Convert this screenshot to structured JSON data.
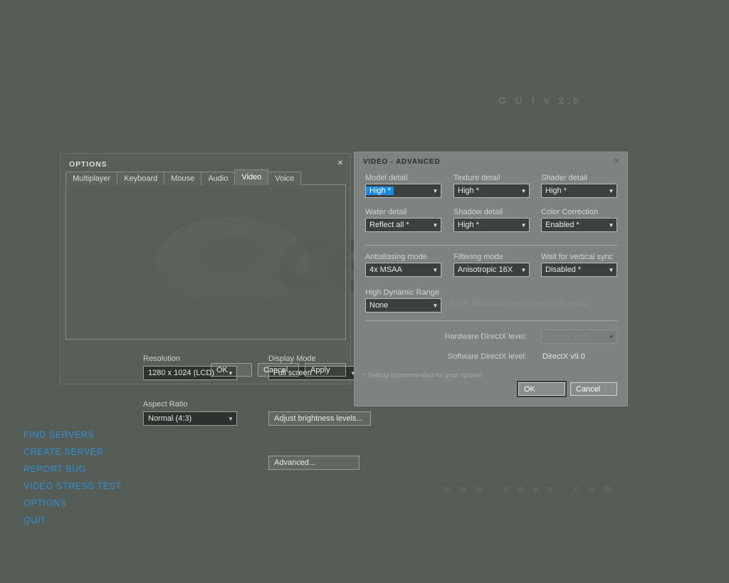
{
  "background": {
    "gui_version": "G U I    v 2.0",
    "site_url": "w w w . c e v o . c o m",
    "watermark_text": "cevo",
    "bg_color": "#565c56"
  },
  "main_menu": {
    "items": [
      {
        "label": "FIND SERVERS"
      },
      {
        "label": "CREATE SERVER"
      },
      {
        "label": "REPORT BUG"
      },
      {
        "label": "VIDEO STRESS TEST"
      },
      {
        "label": "OPTIONS"
      },
      {
        "label": "QUIT"
      }
    ],
    "color": "#2f8fd6"
  },
  "options_window": {
    "title": "OPTIONS",
    "close_label": "×",
    "tabs": [
      {
        "label": "Multiplayer",
        "active": false
      },
      {
        "label": "Keyboard",
        "active": false
      },
      {
        "label": "Mouse",
        "active": false
      },
      {
        "label": "Audio",
        "active": false
      },
      {
        "label": "Video",
        "active": true
      },
      {
        "label": "Voice",
        "active": false
      }
    ],
    "video": {
      "resolution_label": "Resolution",
      "resolution_value": "1280 x 1024 (LCD)",
      "display_mode_label": "Display Mode",
      "display_mode_value": "Full screen",
      "aspect_ratio_label": "Aspect Ratio",
      "aspect_ratio_value": "Normal (4:3)",
      "brightness_button": "Adjust brightness levels...",
      "advanced_button": "Advanced..."
    },
    "footer": {
      "ok": "OK",
      "cancel": "Cancel",
      "apply": "Apply"
    }
  },
  "advanced_window": {
    "title": "VIDEO - ADVANCED",
    "close_label": "×",
    "settings_row1": [
      {
        "label": "Model detail",
        "value": "High *",
        "selected": true
      },
      {
        "label": "Texture detail",
        "value": "High *",
        "selected": false
      },
      {
        "label": "Shader detail",
        "value": "High *",
        "selected": false
      }
    ],
    "settings_row2": [
      {
        "label": "Water detail",
        "value": "Reflect all *",
        "selected": false
      },
      {
        "label": "Shadow detail",
        "value": "High *",
        "selected": false
      },
      {
        "label": "Color Correction",
        "value": "Enabled *",
        "selected": false
      }
    ],
    "settings_row3": [
      {
        "label": "Antialiasing mode",
        "value": "4x MSAA",
        "selected": false
      },
      {
        "label": "Filtering mode",
        "value": "Anisotropic 16X",
        "selected": false
      },
      {
        "label": "Wait for vertical sync",
        "value": "Disabled *",
        "selected": false
      }
    ],
    "hdr": {
      "label": "High Dynamic Range",
      "value": "None",
      "hint": "(HDR effects appear only in HDR maps)"
    },
    "directx": {
      "hardware_label": "Hardware DirectX level:",
      "hardware_value": "DirectX v9.0",
      "software_label": "Software DirectX level:",
      "software_value": "DirectX v9.0"
    },
    "footnote": "* Setting recommended for your system",
    "buttons": {
      "ok": "OK",
      "cancel": "Cancel"
    },
    "highlight_color": "#1a8ae5"
  }
}
